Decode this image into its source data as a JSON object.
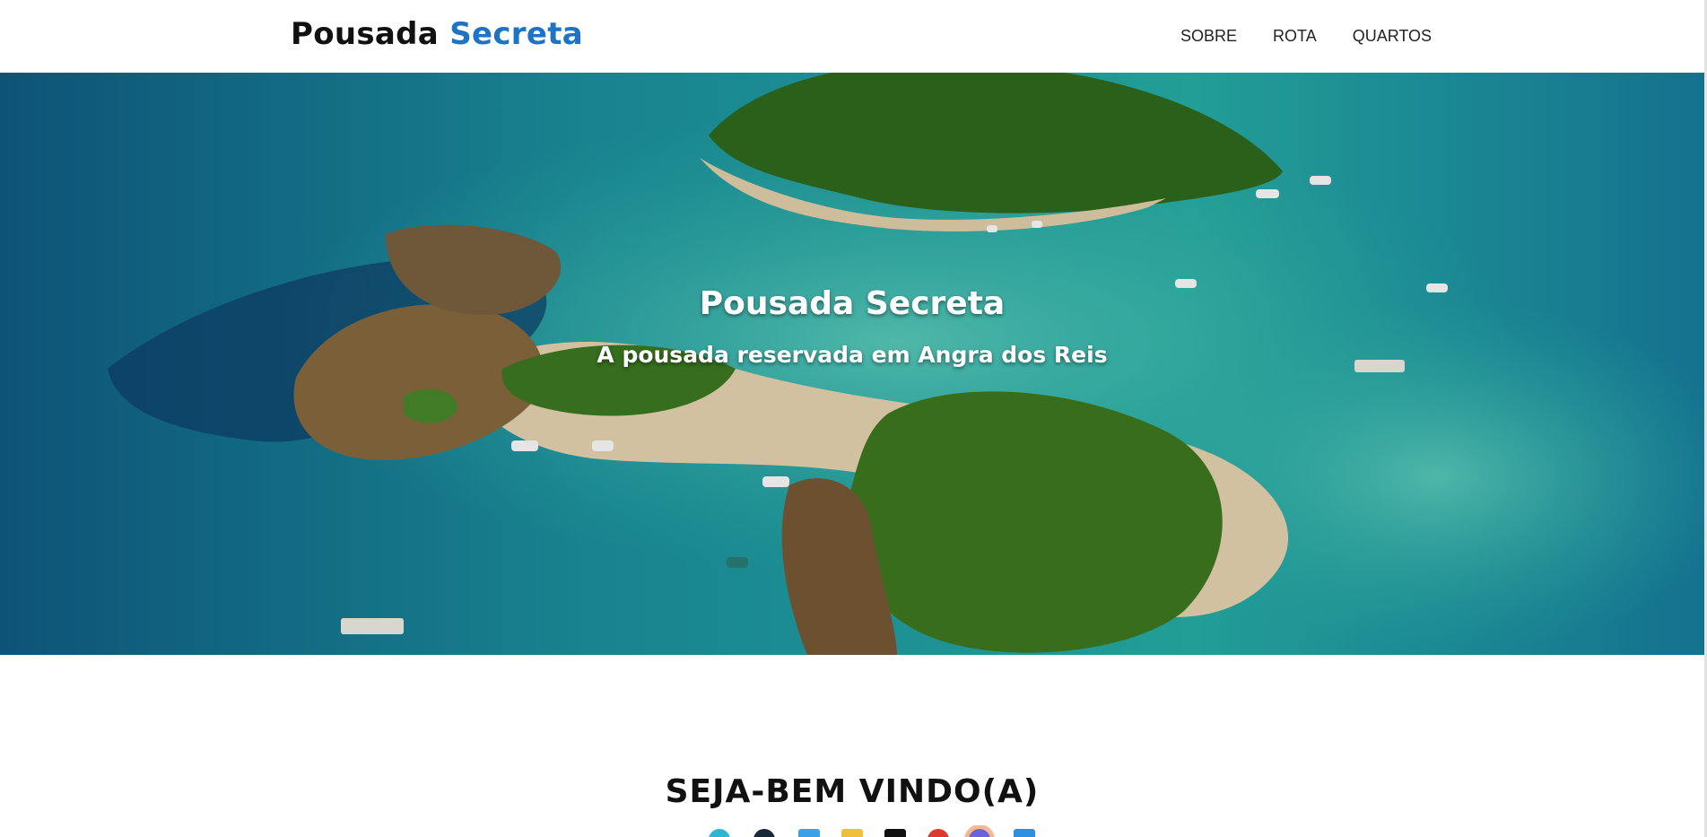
{
  "header": {
    "brand_primary": "Pousada",
    "brand_accent": "Secreta",
    "accent_color": "#1f73c4",
    "nav": [
      {
        "label": "SOBRE"
      },
      {
        "label": "ROTA"
      },
      {
        "label": "QUARTOS"
      }
    ]
  },
  "hero": {
    "title": "Pousada Secreta",
    "subtitle": "A pousada reservada em Angra dos Reis",
    "image": "aerial-island-beach"
  },
  "main": {
    "welcome_heading": "SEJA-BEM VINDO(A)"
  }
}
